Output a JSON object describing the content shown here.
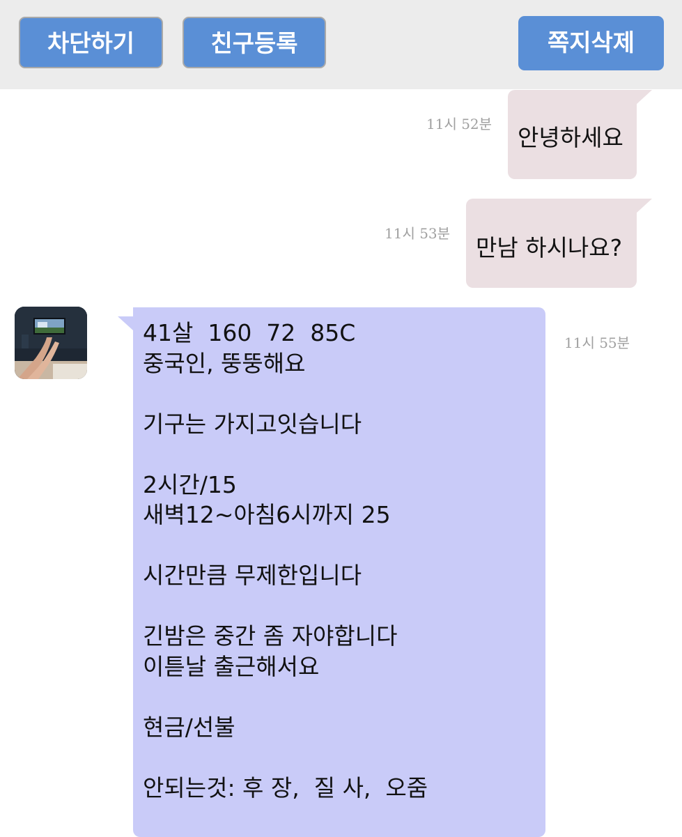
{
  "toolbar": {
    "block_label": "차단하기",
    "friend_label": "친구등록",
    "delete_label": "쪽지삭제"
  },
  "messages": [
    {
      "direction": "sent",
      "text": "안녕하세요",
      "time": "11시 52분"
    },
    {
      "direction": "sent",
      "text": "만남 하시나요?",
      "time": "11시 53분"
    },
    {
      "direction": "received",
      "time": "11시 55분",
      "avatar_icon": "profile-photo",
      "lines": [
        "41살  160  72  85C",
        "중국인, 뚱뚱해요",
        "",
        "기구는 가지고잇습니다",
        "",
        "2시간/15",
        "새벽12~아침6시까지 25",
        "",
        "시간만큼 무제한입니다",
        "",
        "긴밤은 중간 좀 자야합니다",
        "이튿날 출근해서요",
        "",
        "현금/선불",
        "",
        "안되는것: 후 장,  질 사,  오줌"
      ]
    }
  ],
  "colors": {
    "toolbar_bg": "#ececec",
    "button_bg": "#5a8fd6",
    "sent_bubble": "#ebdfe2",
    "received_bubble": "#c9cbf8",
    "timestamp": "#a0a0a0"
  }
}
